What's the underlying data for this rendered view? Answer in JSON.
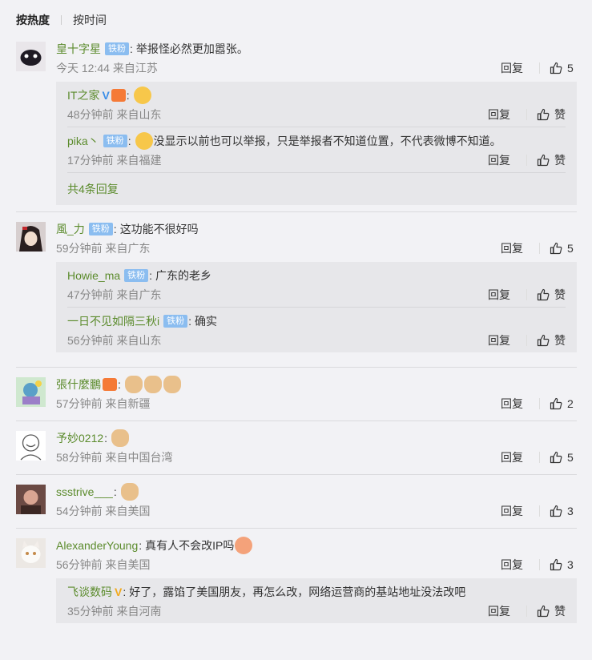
{
  "sort": {
    "hot": "按热度",
    "time": "按时间"
  },
  "labels": {
    "reply": "回复",
    "like": "赞"
  },
  "comments": [
    {
      "user": "皇十字星",
      "badge": "铁粉",
      "text": "举报怪必然更加嚣张。",
      "meta": "今天 12:44 来自江苏",
      "likes": "5",
      "replies": [
        {
          "user": "IT之家",
          "meta": "48分钟前 来自山东"
        },
        {
          "user": "pika丶",
          "badge": "铁粉",
          "text": "没显示以前也可以举报，只是举报者不知道位置，不代表微博不知道。",
          "meta": "17分钟前 来自福建"
        }
      ],
      "more": "共4条回复"
    },
    {
      "user": "風_力",
      "badge": "铁粉",
      "text": "这功能不很好吗",
      "meta": "59分钟前 来自广东",
      "likes": "5",
      "replies": [
        {
          "user": "Howie_ma",
          "badge": "铁粉",
          "text": "广东的老乡",
          "meta": "47分钟前 来自广东"
        },
        {
          "user": "一日不见如隔三秋i",
          "badge": "铁粉",
          "text": "确实",
          "meta": "56分钟前 来自山东"
        }
      ]
    },
    {
      "user": "張什麼鵬",
      "meta": "57分钟前 来自新疆",
      "likes": "2"
    },
    {
      "user": "予妙0212",
      "meta": "58分钟前 来自中国台湾",
      "likes": "5"
    },
    {
      "user": "ssstrive___",
      "meta": "54分钟前 来自美国",
      "likes": "3"
    },
    {
      "user": "AlexanderYoung",
      "text": "真有人不会改IP吗",
      "meta": "56分钟前 来自美国",
      "likes": "3",
      "replies": [
        {
          "user": "飞谈数码",
          "text": "好了，露馅了美国朋友，再怎么改，网络运营商的基站地址没法改吧",
          "meta": "35分钟前 来自河南"
        }
      ]
    }
  ]
}
